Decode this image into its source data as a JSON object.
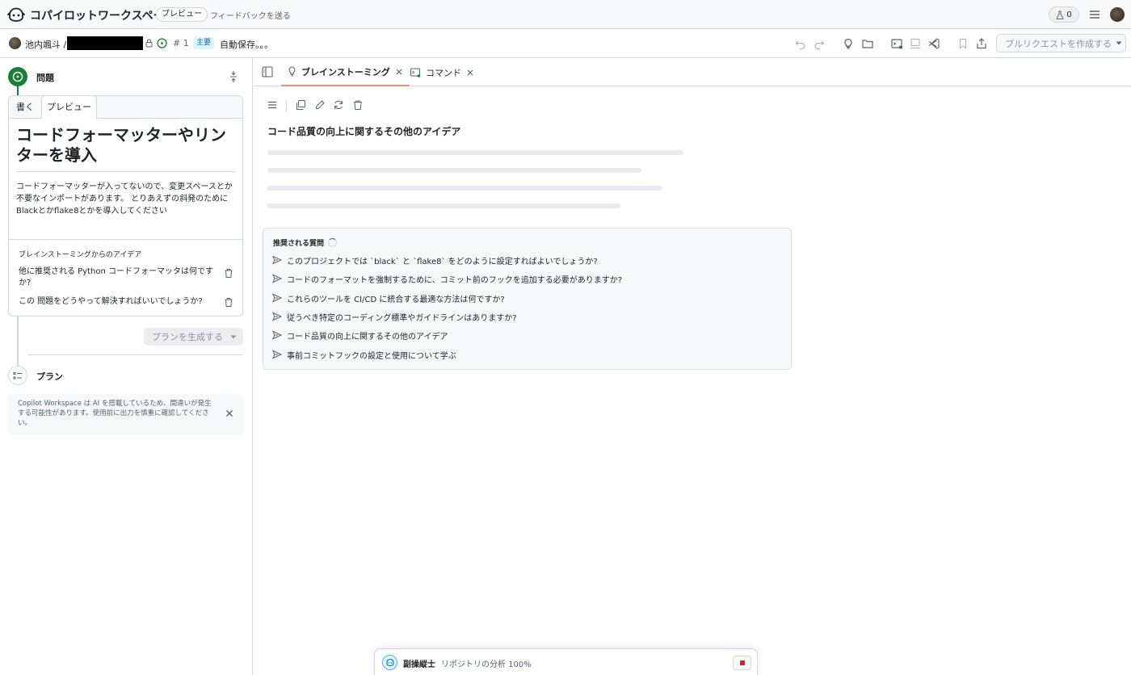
{
  "header": {
    "app_title": "コパイロットワークスペース",
    "preview_badge": "プレビュー",
    "feedback_link": "フィードバックを送る",
    "counter": "0"
  },
  "subbar": {
    "owner": "池内颯斗 /",
    "issue_number": "# 1",
    "branch": "主要",
    "autosave": "自動保存。。。",
    "create_pr": "プルリクエストを作成する"
  },
  "left": {
    "issue_heading": "問題",
    "tabs": {
      "write": "書く",
      "preview": "プレビュー"
    },
    "issue_title": "コードフォーマッターやリンターを導入",
    "issue_body": "コードフォーマッターが入ってないので、変更スペースとか不要なインポートがあります。 とりあえずの斜発のためにBlackとかflake8とかを導入してください",
    "ideas_heading": "ブレインストーミングからのアイデア",
    "ideas": [
      "他に推奨される Python コードフォーマッタは何ですか?",
      "この 問題をどうやって解決すればいいでしょうか?"
    ],
    "generate_plan": "プランを生成する",
    "plan_heading": "プラン",
    "disclaimer": "Copilot Workspace は AI を搭載しているため、間違いが発生する可能性があります。使用前に出力を慎重に確認してください。"
  },
  "right": {
    "tabs": [
      "ブレインストーミング",
      "コマンド"
    ],
    "idea_title": "コード品質の向上に関するその他のアイデア",
    "suggested_heading": "推奨される質問",
    "questions": [
      "このプロジェクトでは `black` と `flake8` をどのように設定すればよいでしょうか?",
      "コードのフォーマットを強制するために、コミット前のフックを追加する必要がありますか?",
      "これらのツールを CI/CD に統合する最適な方法は何ですか?",
      "従うべき特定のコーディング標準やガイドラインはありますか?",
      "コード品質の向上に関するその他のアイデア",
      "事前コミットフックの設定と使用について学ぶ"
    ]
  },
  "status": {
    "agent": "副操縦士",
    "text": "リポジトリの分析 100%"
  },
  "colors": {
    "accent_green": "#1a7f37",
    "tab_underline": "#fd8c73",
    "stop_red": "#cf222e"
  },
  "icons": [
    "copilot-logo-icon",
    "beaker-icon",
    "hamburger-icon",
    "lock-icon",
    "issue-open-icon",
    "undo-icon",
    "redo-icon",
    "lightbulb-icon",
    "folder-icon",
    "terminal-icon",
    "server-icon",
    "vscode-icon",
    "bookmark-icon",
    "share-icon",
    "trash-icon",
    "send-icon",
    "copy-icon",
    "pencil-icon",
    "refresh-icon",
    "sidebar-toggle-icon",
    "close-icon",
    "stop-icon"
  ]
}
